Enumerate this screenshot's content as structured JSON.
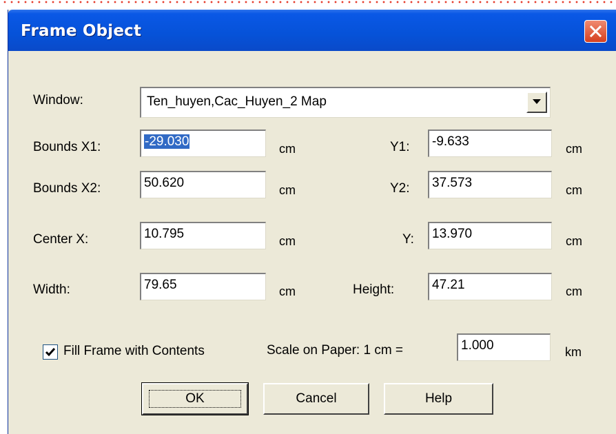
{
  "dialog": {
    "title": "Frame Object"
  },
  "window_field": {
    "label": "Window:",
    "value": "Ten_huyen,Cac_Huyen_2 Map"
  },
  "bounds": {
    "x1_label": "Bounds X1:",
    "x1_value": "-29.030",
    "y1_label": "Y1:",
    "y1_value": "-9.633",
    "x2_label": "Bounds X2:",
    "x2_value": "50.620",
    "y2_label": "Y2:",
    "y2_value": "37.573"
  },
  "center": {
    "x_label": "Center X:",
    "x_value": "10.795",
    "y_label": "Y:",
    "y_value": "13.970"
  },
  "size": {
    "width_label": "Width:",
    "width_value": "79.65",
    "height_label": "Height:",
    "height_value": "47.21"
  },
  "unit": "cm",
  "fill_frame": {
    "label": "Fill Frame with Contents",
    "checked": true
  },
  "scale": {
    "label": "Scale on Paper: 1 cm =",
    "value": "1.000",
    "unit": "km"
  },
  "buttons": {
    "ok": "OK",
    "cancel": "Cancel",
    "help": "Help"
  },
  "colors": {
    "titlebar": "#0652d8",
    "dialog_bg": "#ece9d8",
    "selection": "#316ac5",
    "close_button": "#d5401f"
  }
}
